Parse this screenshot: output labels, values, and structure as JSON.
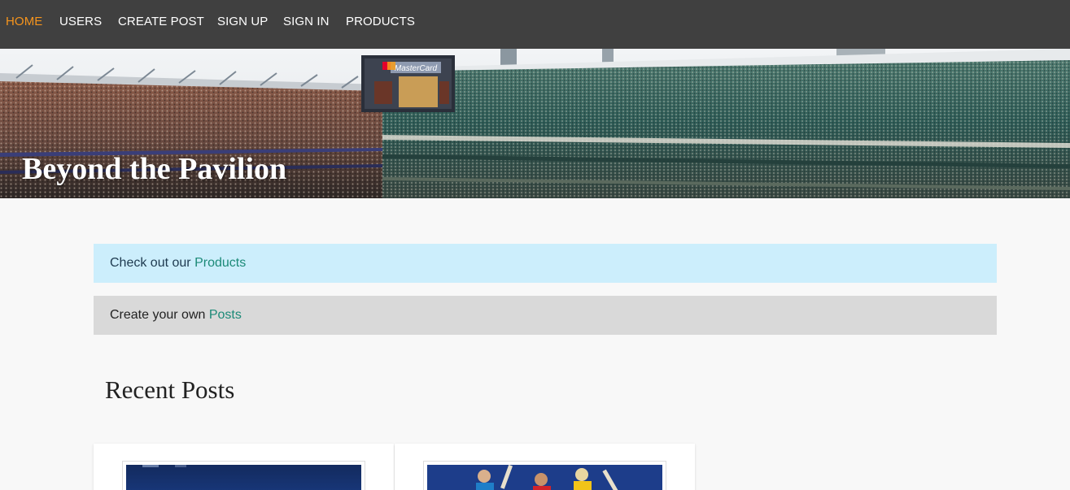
{
  "nav": {
    "items": [
      {
        "label": "HOME",
        "active": true
      },
      {
        "label": "USERS",
        "active": false
      },
      {
        "label": "CREATE POST",
        "active": false
      },
      {
        "label": "SIGN UP",
        "active": false
      },
      {
        "label": "SIGN IN",
        "active": false
      },
      {
        "label": "PRODUCTS",
        "active": false
      }
    ],
    "active_color": "#f5941d"
  },
  "hero": {
    "title": "Beyond the Pavilion",
    "scoreboard_text": "MasterCard"
  },
  "notices": {
    "products": {
      "prefix": "Check out our ",
      "link": "Products"
    },
    "posts": {
      "prefix": "Create your own ",
      "link": "Posts"
    }
  },
  "recent": {
    "heading": "Recent Posts"
  },
  "colors": {
    "nav_bg": "#404040",
    "info_bg": "#cceefc",
    "plain_bg": "#d9d9d9",
    "link": "#1c8a78"
  }
}
